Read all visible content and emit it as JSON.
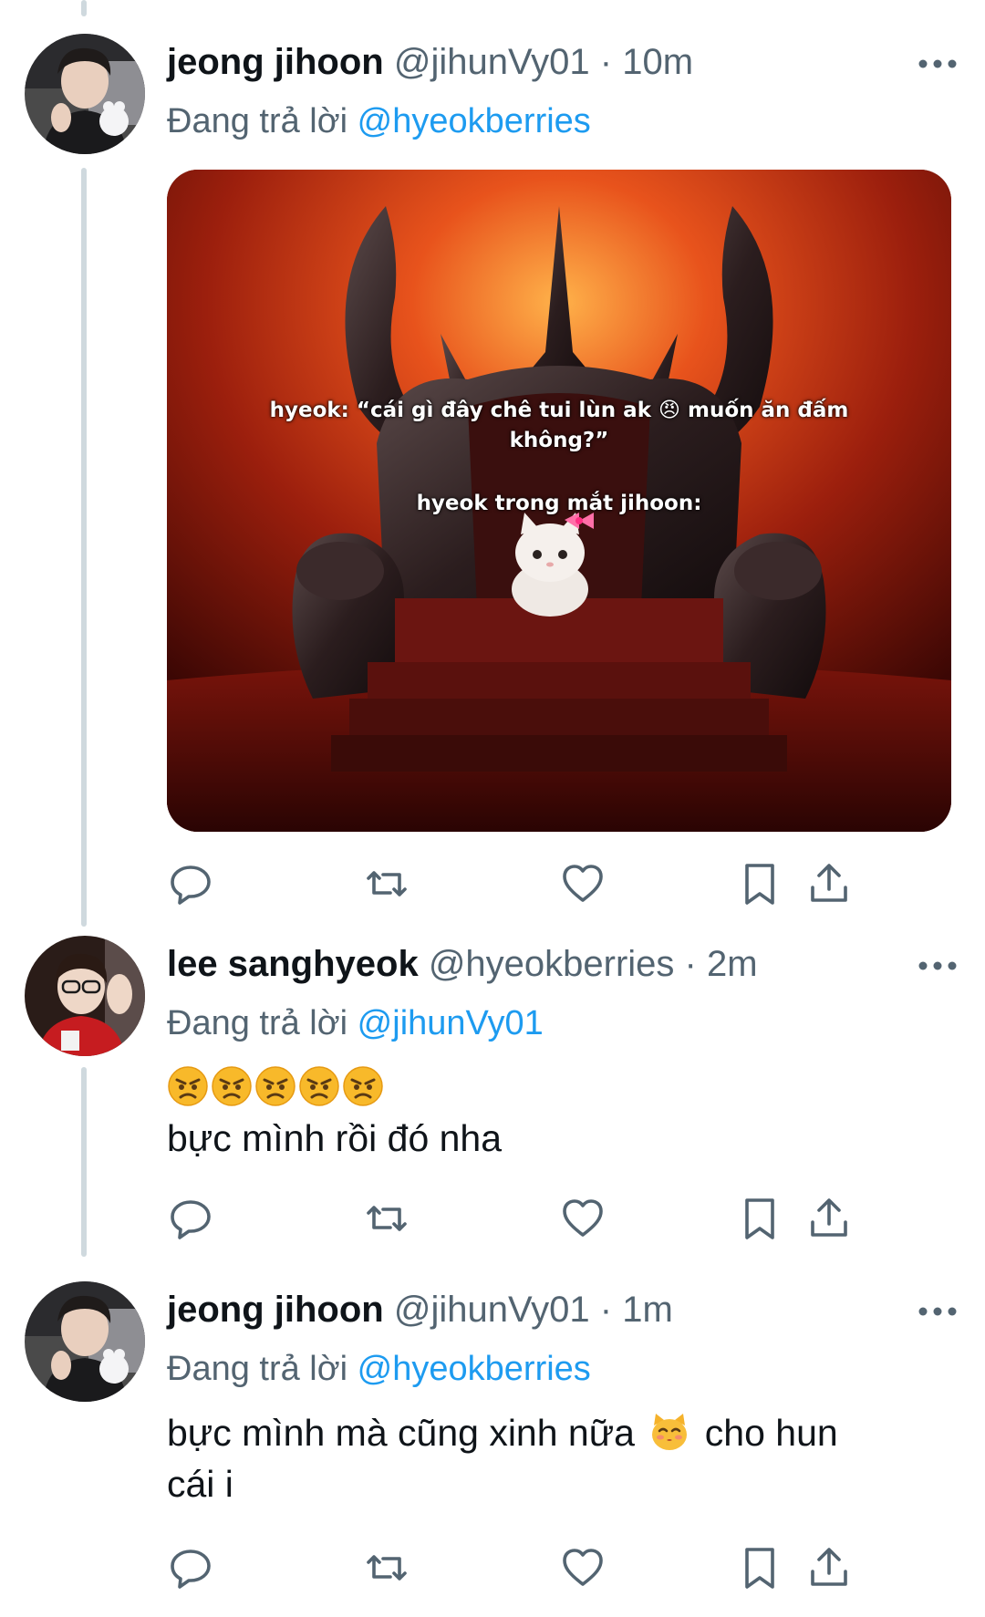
{
  "thread": {
    "tweets": [
      {
        "display_name": "jeong jihoon",
        "handle": "@jihunVy01",
        "separator": "·",
        "time": "10m",
        "reply_prefix": "Đang trả lời",
        "reply_to": "@hyeokberries",
        "media": {
          "caption_line1": "hyeok: “cái gì đây chê tui lùn ak 😠 muốn ăn đấm",
          "caption_line2": "không?”",
          "caption_line3": "hyeok trong mắt jihoon:"
        }
      },
      {
        "display_name": "lee sanghyeok",
        "handle": "@hyeokberries",
        "separator": "·",
        "time": "2m",
        "reply_prefix": "Đang trả lời",
        "reply_to": "@jihunVy01",
        "emoji_count": 5,
        "text": "bực mình rồi đó nha"
      },
      {
        "display_name": "jeong jihoon",
        "handle": "@jihunVy01",
        "separator": "·",
        "time": "1m",
        "reply_prefix": "Đang trả lời",
        "reply_to": "@hyeokberries",
        "text_line1": "bực mình mà cũng xinh nữa",
        "text_line1_end": "cho hun",
        "text_line2": "cái i"
      }
    ]
  },
  "icons": {
    "reply": "reply-icon",
    "retweet": "retweet-icon",
    "like": "heart-icon",
    "bookmark": "bookmark-icon",
    "share": "share-icon",
    "more": "more-icon"
  },
  "colors": {
    "link": "#1d9bf0",
    "secondary": "#536471",
    "text": "#0f1419",
    "thread_line": "#cfd9de"
  }
}
